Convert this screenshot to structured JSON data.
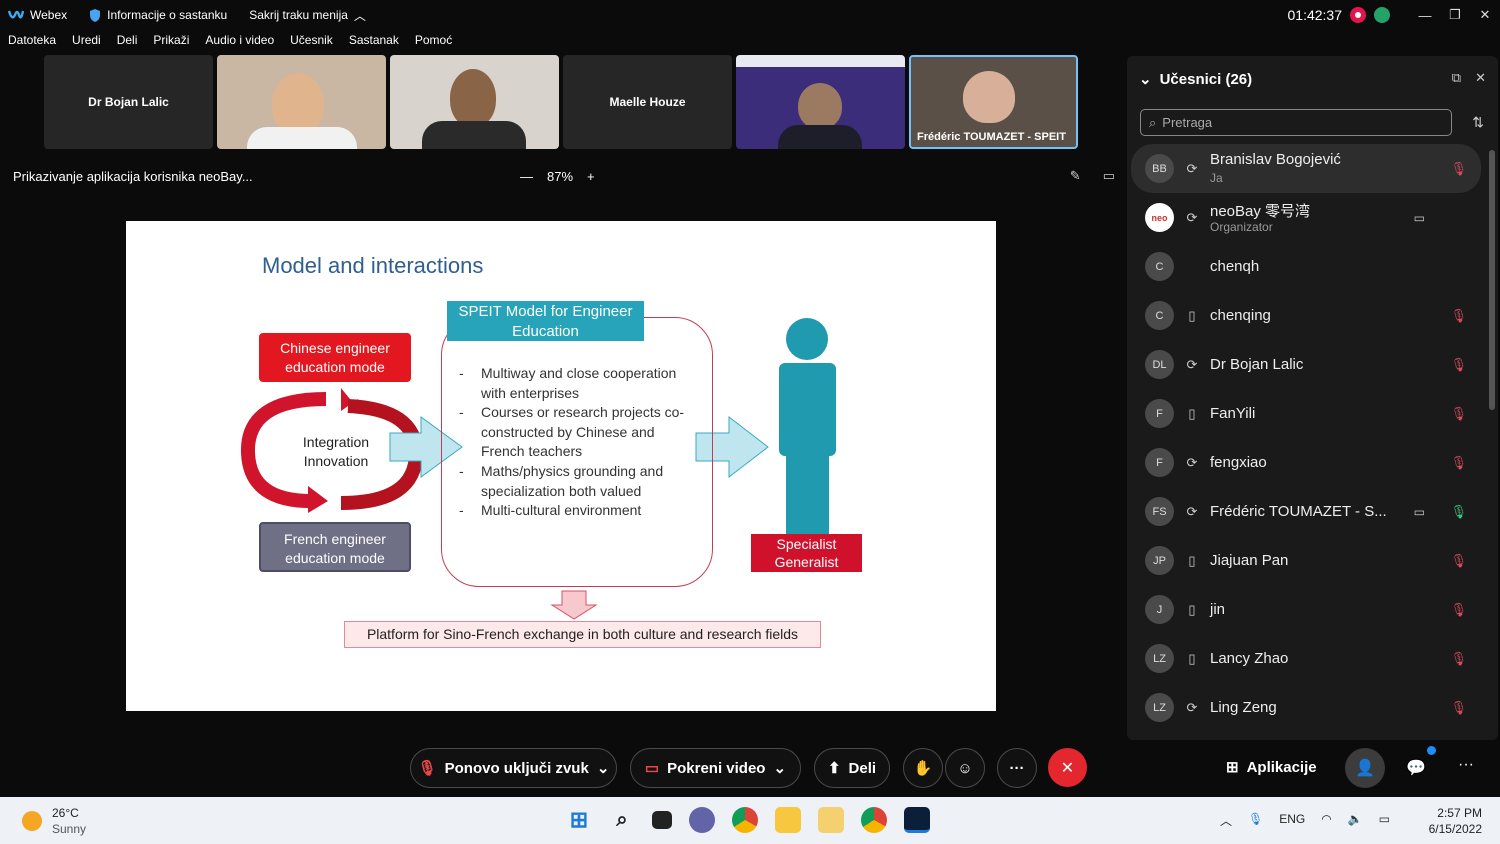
{
  "titlebar": {
    "app_name": "Webex",
    "meeting_info": "Informacije o sastanku",
    "hide_menu": "Sakrij traku menija",
    "clock": "01:42:37"
  },
  "menu": [
    "Datoteka",
    "Uredi",
    "Deli",
    "Prikaži",
    "Audio i video",
    "Učesnik",
    "Sastanak",
    "Pomoć"
  ],
  "strip": {
    "tile1_name": "Dr Bojan Lalic",
    "tile4_name": "Maelle Houze",
    "tile6_caption": "Frédéric TOUMAZET - SPEIT"
  },
  "share": {
    "title": "Prikazivanje aplikacija korisnika neoBay...",
    "zoom_minus": "—",
    "zoom": "87%",
    "zoom_plus": "+"
  },
  "slide": {
    "title": "Model and interactions",
    "chinese_mode": "Chinese engineer education mode",
    "french_mode": "French engineer education mode",
    "integration": "Integration Innovation",
    "speit_header": "SPEIT Model for Engineer Education",
    "bullets": [
      "Multiway and close cooperation with enterprises",
      "Courses or research projects co-constructed by Chinese and French teachers",
      "Maths/physics grounding and specialization both valued",
      "Multi-cultural environment"
    ],
    "specialist": "Specialist",
    "generalist": "Generalist",
    "platform": "Platform for Sino-French exchange in both culture and research fields"
  },
  "panel": {
    "title": "Učesnici (26)",
    "search_placeholder": "Pretraga",
    "participants": [
      {
        "initials": "BB",
        "name": "Branislav Bogojević",
        "role": "Ja"
      },
      {
        "initials": "",
        "name": "neoBay 零号湾",
        "role": "Organizator"
      },
      {
        "initials": "C",
        "name": "chenqh",
        "role": ""
      },
      {
        "initials": "C",
        "name": "chenqing",
        "role": ""
      },
      {
        "initials": "DL",
        "name": "Dr Bojan Lalic",
        "role": ""
      },
      {
        "initials": "F",
        "name": "FanYili",
        "role": ""
      },
      {
        "initials": "F",
        "name": "fengxiao",
        "role": ""
      },
      {
        "initials": "FS",
        "name": "Frédéric TOUMAZET - S...",
        "role": ""
      },
      {
        "initials": "JP",
        "name": "Jiajuan Pan",
        "role": ""
      },
      {
        "initials": "J",
        "name": "jin",
        "role": ""
      },
      {
        "initials": "LZ",
        "name": "Lancy Zhao",
        "role": ""
      },
      {
        "initials": "LZ",
        "name": "Ling Zeng",
        "role": ""
      }
    ]
  },
  "controls": {
    "unmute": "Ponovo uključi zvuk",
    "start_video": "Pokreni video",
    "share": "Deli",
    "apps": "Aplikacije"
  },
  "taskbar": {
    "temp": "26°C",
    "weather": "Sunny",
    "lang": "ENG",
    "time": "2:57 PM",
    "date": "6/15/2022"
  },
  "colors": {
    "accent_blue": "#6ec3ff",
    "end_red": "#e4262e",
    "slide_title": "#2f5e8f",
    "speit_teal": "#27a4b9"
  }
}
